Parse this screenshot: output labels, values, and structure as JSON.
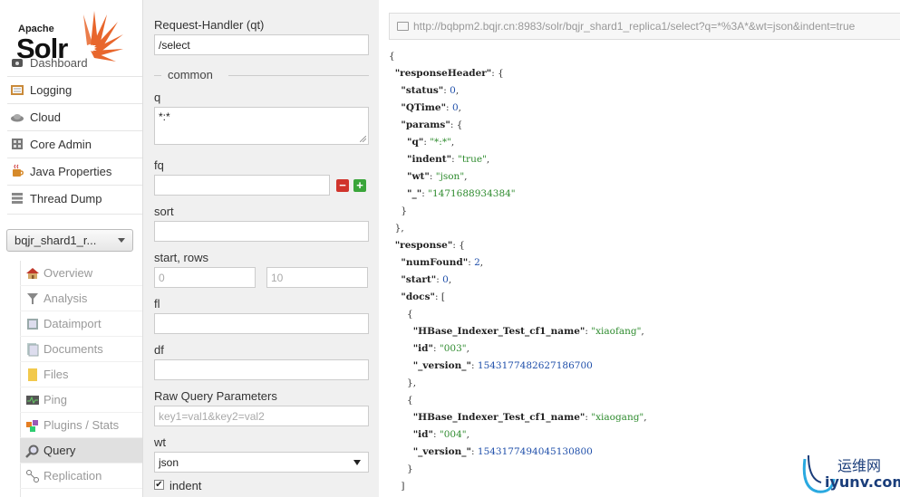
{
  "logo": {
    "apache": "Apache",
    "solr": "Solr"
  },
  "nav": {
    "items": [
      {
        "label": "Dashboard",
        "icon": "dashboard-icon"
      },
      {
        "label": "Logging",
        "icon": "logging-icon"
      },
      {
        "label": "Cloud",
        "icon": "cloud-icon"
      },
      {
        "label": "Core Admin",
        "icon": "core-admin-icon"
      },
      {
        "label": "Java Properties",
        "icon": "java-icon"
      },
      {
        "label": "Thread Dump",
        "icon": "thread-dump-icon"
      }
    ],
    "core_selector": "bqjr_shard1_r...",
    "core_items": [
      {
        "label": "Overview",
        "icon": "home-icon"
      },
      {
        "label": "Analysis",
        "icon": "filter-icon"
      },
      {
        "label": "Dataimport",
        "icon": "dataimport-icon"
      },
      {
        "label": "Documents",
        "icon": "documents-icon"
      },
      {
        "label": "Files",
        "icon": "files-icon"
      },
      {
        "label": "Ping",
        "icon": "ping-icon"
      },
      {
        "label": "Plugins / Stats",
        "icon": "plugins-icon"
      },
      {
        "label": "Query",
        "icon": "search-icon"
      },
      {
        "label": "Replication",
        "icon": "replication-icon"
      }
    ]
  },
  "form": {
    "handler_label": "Request-Handler (qt)",
    "handler_value": "/select",
    "group_title": "common",
    "q_label": "q",
    "q_value": "*:*",
    "fq_label": "fq",
    "remove_label": "−",
    "add_label": "+",
    "sort_label": "sort",
    "start_rows_label": "start, rows",
    "start_placeholder": "0",
    "rows_placeholder": "10",
    "fl_label": "fl",
    "df_label": "df",
    "raw_label": "Raw Query Parameters",
    "raw_placeholder": "key1=val1&key2=val2",
    "wt_label": "wt",
    "wt_value": "json",
    "indent_label": "indent",
    "indent_checked": "✔"
  },
  "response": {
    "url": "http://bqbpm2.bqjr.cn:8983/solr/bqjr_shard1_replica1/select?q=*%3A*&wt=json&indent=true",
    "json_lines": [
      [
        "{"
      ],
      [
        "  ",
        {
          "k": "\"responseHeader\""
        },
        ": {"
      ],
      [
        "    ",
        {
          "k": "\"status\""
        },
        ": ",
        {
          "n": "0"
        },
        ","
      ],
      [
        "    ",
        {
          "k": "\"QTime\""
        },
        ": ",
        {
          "n": "0"
        },
        ","
      ],
      [
        "    ",
        {
          "k": "\"params\""
        },
        ": {"
      ],
      [
        "      ",
        {
          "k": "\"q\""
        },
        ": ",
        {
          "s": "\"*:*\""
        },
        ","
      ],
      [
        "      ",
        {
          "k": "\"indent\""
        },
        ": ",
        {
          "s": "\"true\""
        },
        ","
      ],
      [
        "      ",
        {
          "k": "\"wt\""
        },
        ": ",
        {
          "s": "\"json\""
        },
        ","
      ],
      [
        "      ",
        {
          "k": "\"_\""
        },
        ": ",
        {
          "s": "\"1471688934384\""
        }
      ],
      [
        "    }"
      ],
      [
        "  },"
      ],
      [
        "  ",
        {
          "k": "\"response\""
        },
        ": {"
      ],
      [
        "    ",
        {
          "k": "\"numFound\""
        },
        ": ",
        {
          "n": "2"
        },
        ","
      ],
      [
        "    ",
        {
          "k": "\"start\""
        },
        ": ",
        {
          "n": "0"
        },
        ","
      ],
      [
        "    ",
        {
          "k": "\"docs\""
        },
        ": ["
      ],
      [
        "      {"
      ],
      [
        "        ",
        {
          "k": "\"HBase_Indexer_Test_cf1_name\""
        },
        ": ",
        {
          "s": "\"xiaofang\""
        },
        ","
      ],
      [
        "        ",
        {
          "k": "\"id\""
        },
        ": ",
        {
          "s": "\"003\""
        },
        ","
      ],
      [
        "        ",
        {
          "k": "\"_version_\""
        },
        ": ",
        {
          "n": "1543177482627186700"
        }
      ],
      [
        "      },"
      ],
      [
        "      {"
      ],
      [
        "        ",
        {
          "k": "\"HBase_Indexer_Test_cf1_name\""
        },
        ": ",
        {
          "s": "\"xiaogang\""
        },
        ","
      ],
      [
        "        ",
        {
          "k": "\"id\""
        },
        ": ",
        {
          "s": "\"004\""
        },
        ","
      ],
      [
        "        ",
        {
          "k": "\"_version_\""
        },
        ": ",
        {
          "n": "1543177494045130800"
        }
      ],
      [
        "      }"
      ],
      [
        "    ]"
      ]
    ]
  },
  "watermark": {
    "line1": "运维网",
    "line2": "iyunv.com"
  }
}
